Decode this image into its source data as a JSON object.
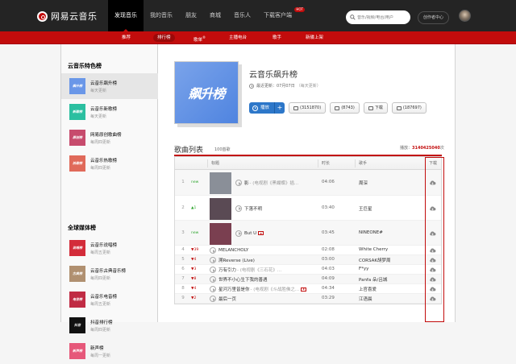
{
  "header": {
    "logo_text": "网易云音乐",
    "nav": [
      {
        "label": "发现音乐",
        "active": true
      },
      {
        "label": "我的音乐",
        "active": false
      },
      {
        "label": "朋友",
        "active": false
      },
      {
        "label": "商城",
        "active": false
      },
      {
        "label": "音乐人",
        "active": false
      },
      {
        "label": "下载客户端",
        "active": false,
        "badge": "HOT"
      }
    ],
    "search_placeholder": "音乐/视频/电台/用户",
    "creator_center": "创作者中心"
  },
  "subnav": [
    {
      "label": "推荐",
      "active": false
    },
    {
      "label": "排行榜",
      "active": true
    },
    {
      "label": "歌单",
      "active": false,
      "sup": "®"
    },
    {
      "label": "主播电台",
      "active": false
    },
    {
      "label": "歌手",
      "active": false
    },
    {
      "label": "新碟上架",
      "active": false
    }
  ],
  "sidebar": {
    "section1_title": "云音乐特色榜",
    "section1": [
      {
        "name": "云音乐飙升榜",
        "sub": "每天更新",
        "active": true,
        "thumb_text": "飙升榜",
        "color": "#6a97e8"
      },
      {
        "name": "云音乐新歌榜",
        "sub": "每天更新",
        "active": false,
        "thumb_text": "新歌榜",
        "color": "#2bbfa0"
      },
      {
        "name": "网易原创歌曲榜",
        "sub": "每周四更新",
        "active": false,
        "thumb_text": "原创榜",
        "color": "#c74b6d"
      },
      {
        "name": "云音乐热歌榜",
        "sub": "每周四更新",
        "active": false,
        "thumb_text": "热歌榜",
        "color": "#e06a5a"
      }
    ],
    "section2_title": "全球媒体榜",
    "section2": [
      {
        "name": "云音乐说唱榜",
        "sub": "每周五更新",
        "thumb_text": "说唱榜",
        "color": "#d32c3a"
      },
      {
        "name": "云音乐古典音乐榜",
        "sub": "每周四更新",
        "thumb_text": "古典榜",
        "color": "#b09070"
      },
      {
        "name": "云音乐电音榜",
        "sub": "每周五更新",
        "thumb_text": "电音榜",
        "color": "#c02b44"
      },
      {
        "name": "抖音排行榜",
        "sub": "每周四更新",
        "thumb_text": "抖音",
        "color": "#111111"
      },
      {
        "name": "新声榜",
        "sub": "每周一更新",
        "thumb_text": "新声榜",
        "color": "#e6587a"
      }
    ]
  },
  "playlist": {
    "cover_text": "飙升榜",
    "title": "云音乐飙升榜",
    "update_label": "最近更新：07月07日",
    "update_freq": "（每天更新）",
    "play_label": "播放",
    "add_label": "+",
    "collect_label": "(3151870)",
    "share_label": "(8743)",
    "download_label": "下载",
    "comment_label": "(187697)"
  },
  "songs_section": {
    "title": "歌曲列表",
    "count": "100首歌",
    "plays_label": "播放：",
    "plays_value": "3140425040",
    "plays_unit": "次",
    "headers": {
      "title": "标题",
      "time": "时长",
      "singer": "歌手",
      "download": "下载"
    }
  },
  "songs": [
    {
      "rank": "1",
      "trend": "new",
      "trend_text": "new",
      "title": "影",
      "alias": " - (电视剧《黑蝴蝶》插...",
      "time": "04:06",
      "singer": "周深",
      "art": "#8a8f98",
      "mv": false
    },
    {
      "rank": "2",
      "trend": "up",
      "trend_text": "▲1",
      "title": "下落不明",
      "alias": "",
      "time": "03:40",
      "singer": "王巨星",
      "art": "#5a4a54",
      "mv": false
    },
    {
      "rank": "3",
      "trend": "new",
      "trend_text": "new",
      "title": "But U",
      "alias": "",
      "time": "03:45",
      "singer": "NINEONE#",
      "art": "#7a3f50",
      "mv": true
    },
    {
      "rank": "4",
      "trend": "down",
      "trend_text": "▼39",
      "title": "MELANCHOLY",
      "alias": "",
      "time": "02:08",
      "singer": "White Cherry",
      "mv": false
    },
    {
      "rank": "5",
      "trend": "down",
      "trend_text": "▼4",
      "title": "溯Reverse (Live)",
      "alias": "",
      "time": "03:00",
      "singer": "CORSAK胡梦周",
      "mv": false
    },
    {
      "rank": "6",
      "trend": "down",
      "trend_text": "▼3",
      "title": "万有引力",
      "alias": " - (电视剧《三石花》...",
      "time": "04:03",
      "singer": "F*yy",
      "mv": false
    },
    {
      "rank": "7",
      "trend": "down",
      "trend_text": "▼8",
      "title": "世界不小心生下我的善遇",
      "alias": "",
      "time": "04:09",
      "singer": "Panfa 朵/吕城",
      "mv": false
    },
    {
      "rank": "8",
      "trend": "down",
      "trend_text": "▼4",
      "title": "星河万里皆是你",
      "alias": " - (电视剧《斗战胜佛之...",
      "time": "04:34",
      "singer": "上官喜爱",
      "mv": true
    },
    {
      "rank": "9",
      "trend": "down",
      "trend_text": "▼2",
      "title": "最后一页",
      "alias": "",
      "time": "03:29",
      "singer": "江语晨",
      "mv": false
    }
  ]
}
